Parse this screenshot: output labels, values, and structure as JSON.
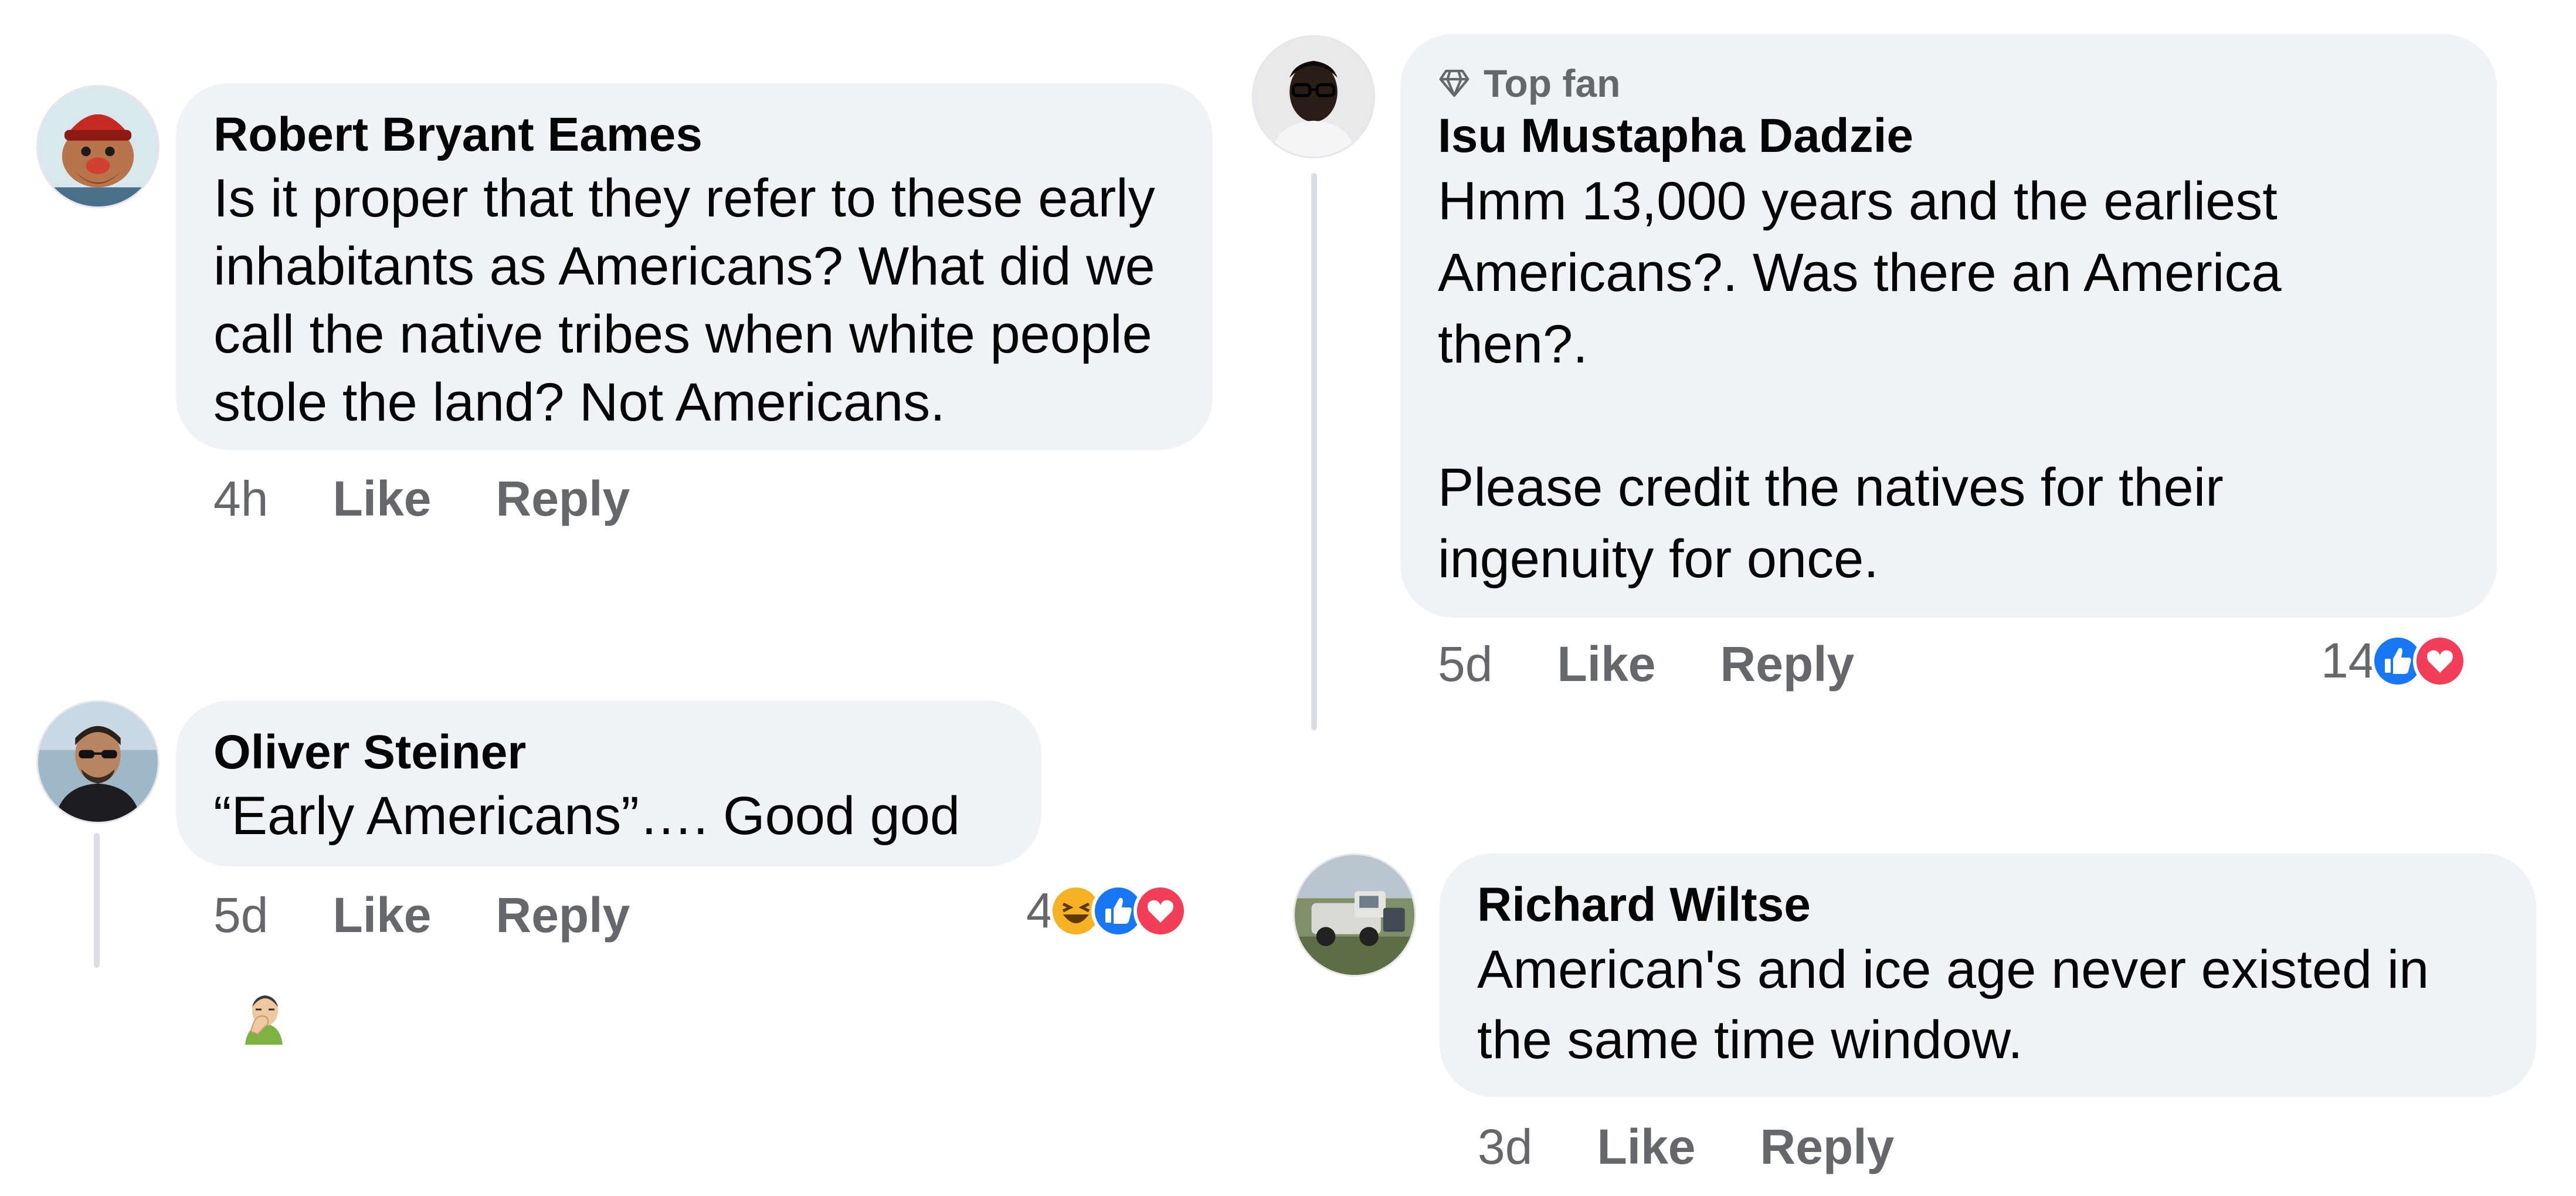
{
  "comments": [
    {
      "author": "Robert Bryant Eames",
      "text": "Is it proper that they refer to these early\ninhabitants as Americans? What did we\ncall the native tribes when white people\nstole the land? Not Americans.",
      "time": "4h",
      "like": "Like",
      "reply": "Reply",
      "avatar_icon": "cartoon-character-avatar"
    },
    {
      "author": "Oliver Steiner",
      "text": "“Early Americans”…. Good god",
      "emoji": "face-palm-emoji",
      "time": "5d",
      "like": "Like",
      "reply": "Reply",
      "reaction_count": "4",
      "reactions": [
        "haha",
        "like",
        "love"
      ],
      "avatar_icon": "man-with-sunglasses-avatar"
    },
    {
      "badge": "Top fan",
      "badge_icon": "diamond-icon",
      "author": "Isu Mustapha Dadzie",
      "text": "Hmm 13,000 years and the earliest\nAmericans?. Was there an America\nthen?.\n\nPlease credit the natives for their\ningenuity for once.",
      "time": "5d",
      "like": "Like",
      "reply": "Reply",
      "reaction_count": "14",
      "reactions": [
        "like",
        "love"
      ],
      "avatar_icon": "man-with-glasses-avatar"
    },
    {
      "author": "Richard Wiltse",
      "text": "American's and ice age never existed in\nthe same time window.",
      "time": "3d",
      "like": "Like",
      "reply": "Reply",
      "avatar_icon": "vintage-truck-avatar"
    }
  ],
  "colors": {
    "bubble": "#f0f2f5",
    "meta_text": "#65676b",
    "like_blue": "#1877f2",
    "love_red": "#f33e58",
    "haha_yellow": "#f7b125",
    "thread_line": "#dadde1"
  }
}
